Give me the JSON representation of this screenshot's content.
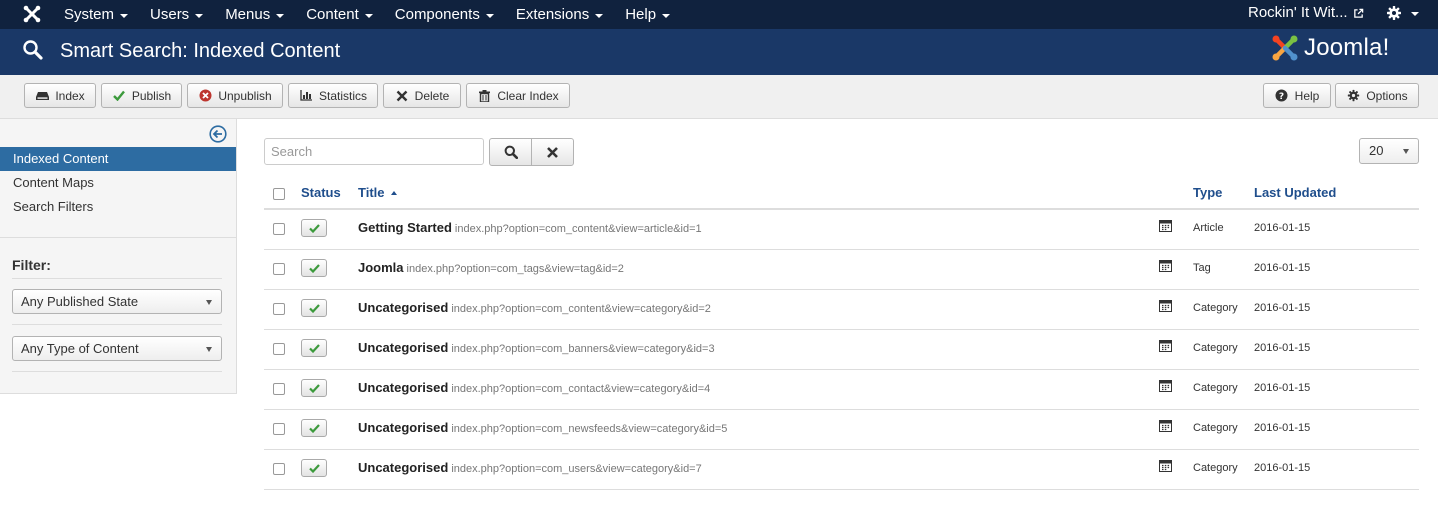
{
  "topnav": {
    "menu": [
      "System",
      "Users",
      "Menus",
      "Content",
      "Components",
      "Extensions",
      "Help"
    ],
    "site_link": "Rockin' It Wit..."
  },
  "header": {
    "title": "Smart Search: Indexed Content",
    "brand": "Joomla!"
  },
  "toolbar": {
    "buttons": [
      "Index",
      "Publish",
      "Unpublish",
      "Statistics",
      "Delete",
      "Clear Index"
    ],
    "right_buttons": [
      "Help",
      "Options"
    ]
  },
  "sidebar": {
    "items": [
      "Indexed Content",
      "Content Maps",
      "Search Filters"
    ],
    "filter_label": "Filter:",
    "filters": [
      "Any Published State",
      "Any Type of Content"
    ]
  },
  "search": {
    "placeholder": "Search"
  },
  "list_limit": "20",
  "table": {
    "headers": {
      "status": "Status",
      "title": "Title",
      "type": "Type",
      "last_updated": "Last Updated"
    },
    "rows": [
      {
        "title": "Getting Started",
        "url": "index.php?option=com_content&view=article&id=1",
        "type": "Article",
        "date": "2016-01-15"
      },
      {
        "title": "Joomla",
        "url": "index.php?option=com_tags&view=tag&id=2",
        "type": "Tag",
        "date": "2016-01-15"
      },
      {
        "title": "Uncategorised",
        "url": "index.php?option=com_content&view=category&id=2",
        "type": "Category",
        "date": "2016-01-15"
      },
      {
        "title": "Uncategorised",
        "url": "index.php?option=com_banners&view=category&id=3",
        "type": "Category",
        "date": "2016-01-15"
      },
      {
        "title": "Uncategorised",
        "url": "index.php?option=com_contact&view=category&id=4",
        "type": "Category",
        "date": "2016-01-15"
      },
      {
        "title": "Uncategorised",
        "url": "index.php?option=com_newsfeeds&view=category&id=5",
        "type": "Category",
        "date": "2016-01-15"
      },
      {
        "title": "Uncategorised",
        "url": "index.php?option=com_users&view=category&id=7",
        "type": "Category",
        "date": "2016-01-15"
      }
    ]
  },
  "colors": {
    "navbar": "#10223e",
    "header": "#1a3867",
    "active": "#2d6ca2",
    "link": "#1f4e8c",
    "check": "#3c9a3c"
  }
}
